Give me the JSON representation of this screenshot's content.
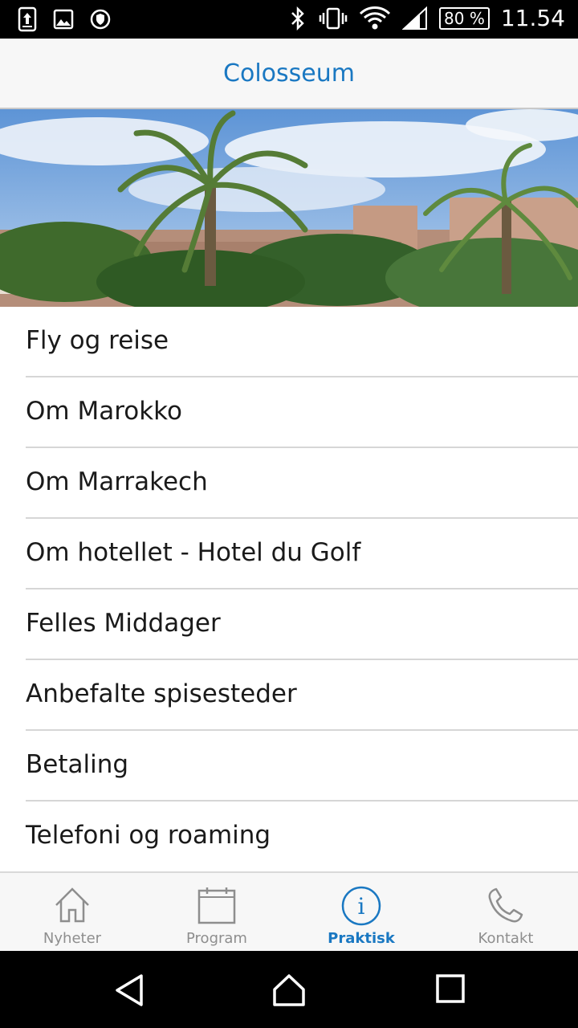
{
  "status_bar": {
    "battery": "80 %",
    "time": "11.54"
  },
  "header": {
    "title": "Colosseum"
  },
  "menu": {
    "items": [
      {
        "label": "Fly og reise"
      },
      {
        "label": "Om Marokko"
      },
      {
        "label": "Om Marrakech"
      },
      {
        "label": "Om hotellet - Hotel du Golf"
      },
      {
        "label": "Felles Middager"
      },
      {
        "label": "Anbefalte spisesteder"
      },
      {
        "label": "Betaling"
      },
      {
        "label": "Telefoni og roaming"
      }
    ]
  },
  "tabs": [
    {
      "label": "Nyheter",
      "icon": "home-icon",
      "active": false
    },
    {
      "label": "Program",
      "icon": "calendar-icon",
      "active": false
    },
    {
      "label": "Praktisk",
      "icon": "info-icon",
      "active": true
    },
    {
      "label": "Kontakt",
      "icon": "phone-icon",
      "active": false
    }
  ],
  "colors": {
    "accent": "#1a78c2",
    "inactive": "#8e8e8e"
  }
}
